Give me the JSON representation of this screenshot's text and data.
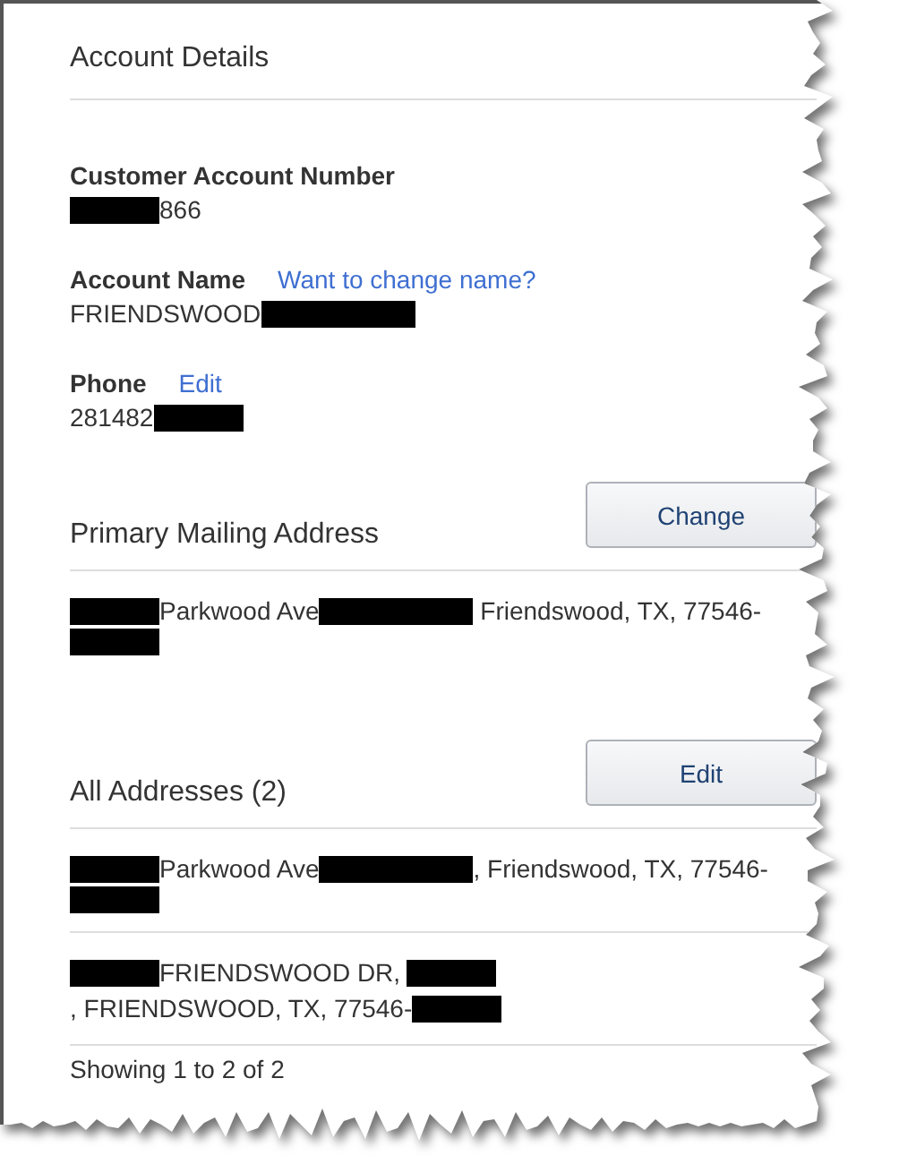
{
  "title": "Account Details",
  "fields": [
    {
      "label": "Customer Account Number",
      "value": [
        {
          "kind": "redacted"
        },
        {
          "kind": "text",
          "text": "866"
        }
      ]
    },
    {
      "label": "Account Name",
      "link": "Want to change name?",
      "value": [
        {
          "kind": "text",
          "text": "FRIENDSWOOD"
        },
        {
          "kind": "redacted_wide"
        }
      ]
    },
    {
      "label": "Phone",
      "link": "Edit",
      "value": [
        {
          "kind": "text",
          "text": "281482"
        },
        {
          "kind": "redacted"
        }
      ]
    }
  ],
  "sections": [
    {
      "heading": "Primary Mailing Address",
      "button": "Change",
      "addresses": [
        [
          {
            "kind": "redacted"
          },
          {
            "kind": "text",
            "text": "Parkwood Ave"
          },
          {
            "kind": "redacted_wide"
          },
          {
            "kind": "text",
            "text": " Friendswood, TX, 77546-"
          },
          {
            "kind": "redacted"
          }
        ]
      ]
    },
    {
      "heading": "All Addresses (2)",
      "button": "Edit",
      "addresses": [
        [
          {
            "kind": "redacted"
          },
          {
            "kind": "text",
            "text": "Parkwood Ave"
          },
          {
            "kind": "redacted_wide"
          },
          {
            "kind": "text",
            "text": ", Friendswood, TX, 77546-"
          },
          {
            "kind": "redacted"
          }
        ],
        [
          {
            "kind": "redacted"
          },
          {
            "kind": "text",
            "text": "FRIENDSWOOD DR, "
          },
          {
            "kind": "redacted"
          },
          {
            "kind": "text",
            "text": ", FRIENDSWOOD, TX, 77546-"
          },
          {
            "kind": "redacted"
          }
        ]
      ],
      "footer": "Showing 1 to 2 of 2"
    }
  ]
}
